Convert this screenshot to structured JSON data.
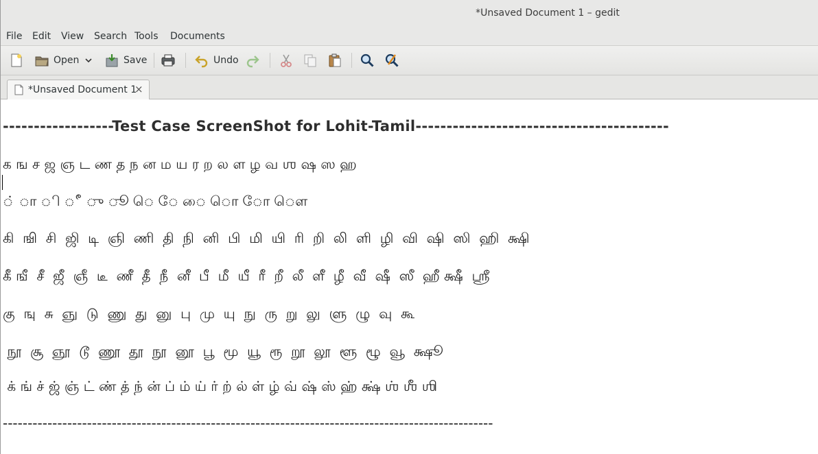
{
  "window": {
    "title": "*Unsaved Document 1 – gedit"
  },
  "menu": [
    "File",
    "Edit",
    "View",
    "Search",
    "Tools",
    "Documents"
  ],
  "toolbar": {
    "open_label": "Open",
    "save_label": "Save",
    "undo_label": "Undo"
  },
  "tab": {
    "label": "*Unsaved Document 1",
    "close": "×"
  },
  "document": {
    "lines": [
      "------------------Test Case ScreenShot for Lohit-Tamil-----------------------------------------",
      "க ங ச ஜ ஞ ட ண த ந ன ம ய ர ற ல ள ழ வ ஶ ஷ ஸ ஹ",
      "் ா ி ீ ு ூ ெ ே ை ொ ோ ௌ",
      "கி  ஙி  சி  ஜி  டி  ஞி  ணி  தி  நி  னி  பி  மி  யி  ரி  றி  லி  ளி  ழி  வி  ஷி  ஸி  ஹி  க்ஷி",
      "கீ ஙீ  சீ  ஜீ  ஞீ  டீ  ணீ  தீ  நீ  னீ  பீ  மீ  யீ  ரீ  றீ  லீ  ளீ  ழீ  வீ  ஷீ  ஸீ  ஹீ க்ஷீ  ஸ்ரீ",
      "கு  ஙு  சு  ஞு  டு  ணு  து  னு  பு  மு  யு  நு  ரு  று  லு  ளு  ழு  வு  கூ",
      " நூ  சூ  ஞூ  டூ  ணூ  தூ  நூ  னூ  பூ  மூ  யூ  ரூ  றூ  லூ  ளூ  ழூ  வூ  க்ஷூ",
      " க் ங் ச் ஜ் ஞ் ட் ண் த் ந் ன் ப் ம் ய் ர் ற் ல் ள் ழ் வ் ஷ் ஸ் ஹ் க்ஷ் ஶ் ஶீ ஶி",
      "---------------------------------------------------------------------------------------------------"
    ]
  },
  "colors": {
    "chrome": "#e8e8e7",
    "text": "#2e3436",
    "editor_bg": "#ffffff"
  }
}
